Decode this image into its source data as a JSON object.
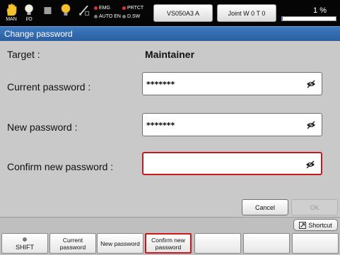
{
  "topbar": {
    "icons": [
      {
        "name": "hand-icon",
        "caption": "MAN"
      },
      {
        "name": "io-bulb-icon",
        "caption": "I/O"
      },
      {
        "name": "stop-square-icon",
        "caption": ""
      },
      {
        "name": "lamp-icon",
        "caption": ""
      },
      {
        "name": "pen-gauge-icon",
        "caption": ""
      }
    ],
    "indicators": [
      {
        "label": "EMG",
        "color": "#e0322a"
      },
      {
        "label": "PRTCT",
        "color": "#e0322a"
      },
      {
        "label": "AUTO EN",
        "color": "#7a7a7a"
      },
      {
        "label": "D.SW",
        "color": "#7a7a7a"
      }
    ],
    "robot_button": "VS050A3 A",
    "joint_button": "Joint W 0 T 0",
    "speed_percent": "1 %",
    "speed_value": 1
  },
  "title": "Change password",
  "form": {
    "target_label": "Target :",
    "target_value": "Maintainer",
    "current_label": "Current password :",
    "current_value": "*******",
    "new_label": "New password :",
    "new_value": "*******",
    "confirm_label": "Confirm new password :",
    "confirm_value": ""
  },
  "actions": {
    "cancel": "Cancel",
    "ok": "OK"
  },
  "shortcut_label": "Shortcut",
  "function_keys": [
    {
      "label": "SHIFT"
    },
    {
      "label": "Current password"
    },
    {
      "label": "New password"
    },
    {
      "label": "Confirm new password"
    },
    {
      "label": ""
    },
    {
      "label": ""
    },
    {
      "label": ""
    }
  ],
  "colors": {
    "accent_title": "#2f67ad",
    "focus_border": "#c8181e",
    "background": "#c9c9c9"
  }
}
